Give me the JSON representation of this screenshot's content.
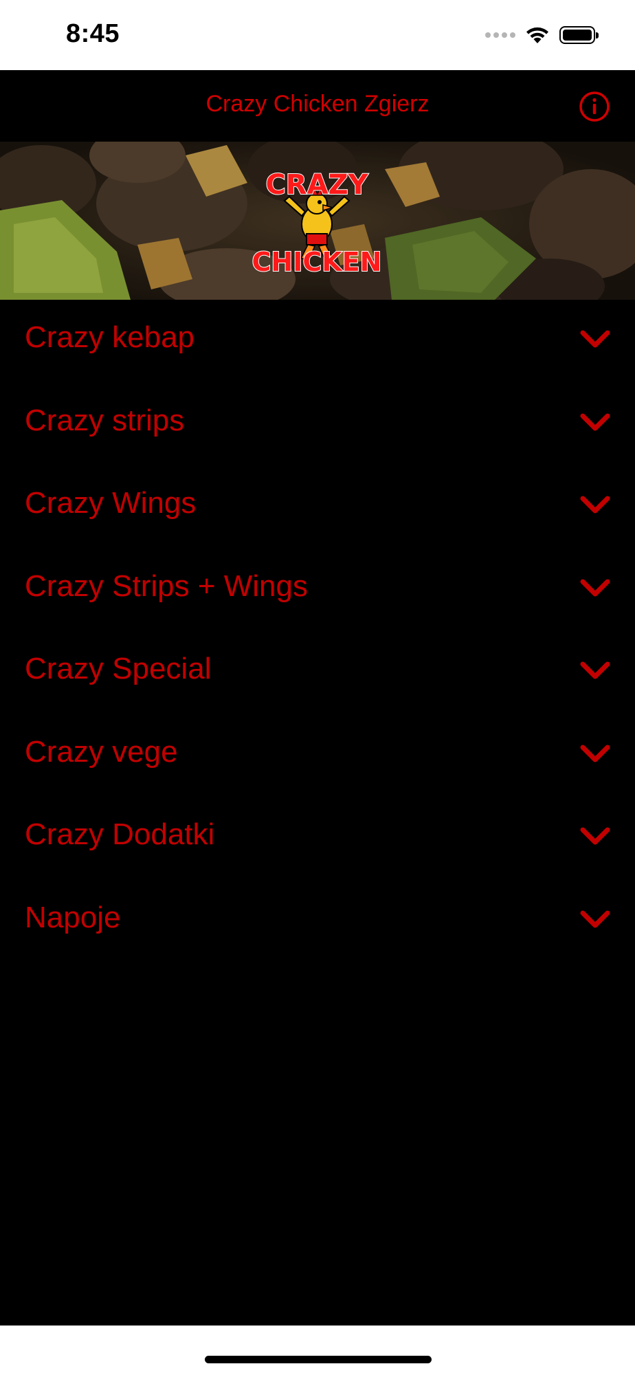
{
  "status_bar": {
    "time": "8:45",
    "icons": [
      "cellular-signal-icon",
      "wifi-icon",
      "battery-icon"
    ]
  },
  "nav": {
    "title": "Crazy Chicken Zgierz",
    "info_icon": "info-circle-icon"
  },
  "banner": {
    "logo_text_top": "CRAZY",
    "logo_text_bottom": "CHICKEN"
  },
  "categories": [
    {
      "label": "Crazy kebap"
    },
    {
      "label": "Crazy strips"
    },
    {
      "label": "Crazy Wings"
    },
    {
      "label": "Crazy Strips + Wings"
    },
    {
      "label": "Crazy Special"
    },
    {
      "label": "Crazy vege"
    },
    {
      "label": "Crazy Dodatki"
    },
    {
      "label": "Napoje"
    }
  ],
  "colors": {
    "accent": "#c20000",
    "background": "#000000",
    "status_bar": "#ffffff"
  }
}
